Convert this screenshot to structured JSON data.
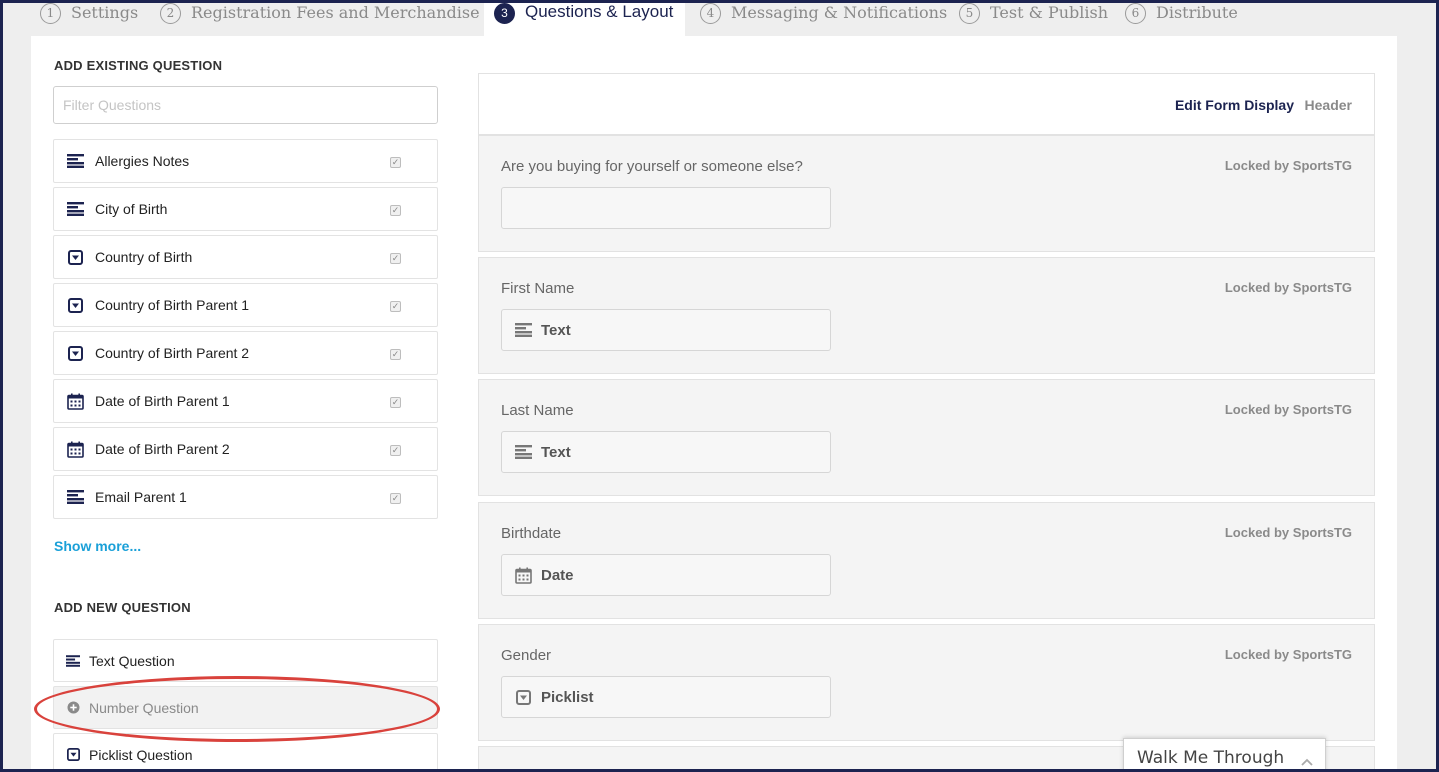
{
  "tabs": [
    {
      "num": "1",
      "label": "Settings"
    },
    {
      "num": "2",
      "label": "Registration Fees and Merchandise"
    },
    {
      "num": "3",
      "label": "Questions & Layout"
    },
    {
      "num": "4",
      "label": "Messaging & Notifications"
    },
    {
      "num": "5",
      "label": "Test & Publish"
    },
    {
      "num": "6",
      "label": "Distribute"
    }
  ],
  "existing": {
    "title": "ADD EXISTING QUESTION",
    "filter_placeholder": "Filter Questions",
    "items": [
      {
        "label": "Allergies Notes",
        "icon": "text-lines-icon"
      },
      {
        "label": "City of Birth",
        "icon": "text-lines-icon"
      },
      {
        "label": "Country of Birth",
        "icon": "picklist-icon"
      },
      {
        "label": "Country of Birth Parent 1",
        "icon": "picklist-icon"
      },
      {
        "label": "Country of Birth Parent 2",
        "icon": "picklist-icon"
      },
      {
        "label": "Date of Birth Parent 1",
        "icon": "calendar-icon"
      },
      {
        "label": "Date of Birth Parent 2",
        "icon": "calendar-icon"
      },
      {
        "label": "Email Parent 1",
        "icon": "text-lines-icon"
      }
    ],
    "show_more": "Show more..."
  },
  "new_question": {
    "title": "ADD NEW QUESTION",
    "items": [
      {
        "label": "Text Question",
        "icon": "text-lines-icon"
      },
      {
        "label": "Number Question",
        "icon": "plus-circle-icon"
      },
      {
        "label": "Picklist Question",
        "icon": "picklist-icon"
      }
    ]
  },
  "form": {
    "edit_label": "Edit Form Display",
    "header_label": "Header",
    "locked_text": "Locked by SportsTG",
    "fields": [
      {
        "label": "Are you buying for yourself or someone else?",
        "type": "",
        "icon": ""
      },
      {
        "label": "First Name",
        "type": "Text",
        "icon": "text-lines-icon"
      },
      {
        "label": "Last Name",
        "type": "Text",
        "icon": "text-lines-icon"
      },
      {
        "label": "Birthdate",
        "type": "Date",
        "icon": "calendar-icon"
      },
      {
        "label": "Gender",
        "type": "Picklist",
        "icon": "picklist-icon"
      }
    ]
  },
  "walk_me_through": "Walk Me Through",
  "colors": {
    "navy": "#1c2350",
    "link": "#1aa0d8",
    "annotation": "#d9423c"
  }
}
